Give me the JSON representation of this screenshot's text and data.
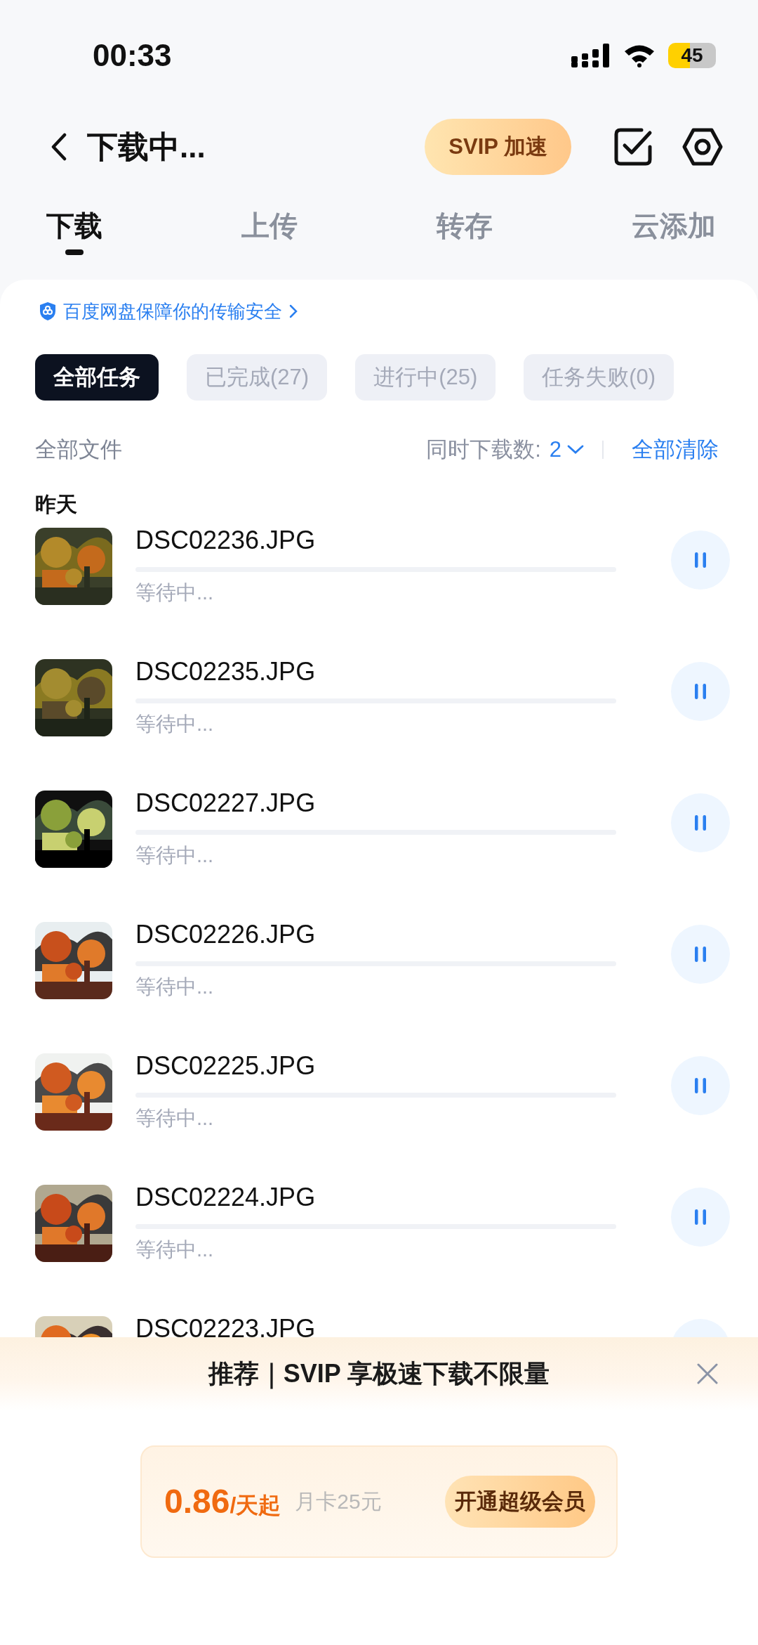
{
  "status_bar": {
    "time": "00:33",
    "battery": "45"
  },
  "header": {
    "title": "下载中...",
    "svip_button": "SVIP 加速"
  },
  "tabs": [
    {
      "label": "下载",
      "selected": true
    },
    {
      "label": "上传",
      "selected": false
    },
    {
      "label": "转存",
      "selected": false
    },
    {
      "label": "云添加",
      "selected": false
    }
  ],
  "security_notice": "百度网盘保障你的传输安全",
  "filters": [
    {
      "label": "全部任务",
      "selected": true
    },
    {
      "label": "已完成(27)",
      "selected": false
    },
    {
      "label": "进行中(25)",
      "selected": false
    },
    {
      "label": "任务失败(0)",
      "selected": false
    }
  ],
  "toolbar": {
    "scope": "全部文件",
    "concurrent_label": "同时下载数:",
    "concurrent_value": "2",
    "clear_all": "全部清除"
  },
  "group_label": "昨天",
  "files": [
    {
      "name": "DSC02236.JPG",
      "status": "等待中..."
    },
    {
      "name": "DSC02235.JPG",
      "status": "等待中..."
    },
    {
      "name": "DSC02227.JPG",
      "status": "等待中..."
    },
    {
      "name": "DSC02226.JPG",
      "status": "等待中..."
    },
    {
      "name": "DSC02225.JPG",
      "status": "等待中..."
    },
    {
      "name": "DSC02224.JPG",
      "status": "等待中..."
    },
    {
      "name": "DSC02223.JPG"
    }
  ],
  "promo": {
    "title": "推荐｜SVIP 享极速下载不限量",
    "price": "0.86",
    "price_unit": "/天起",
    "monthly": "月卡25元",
    "cta": "开通超级会员"
  }
}
